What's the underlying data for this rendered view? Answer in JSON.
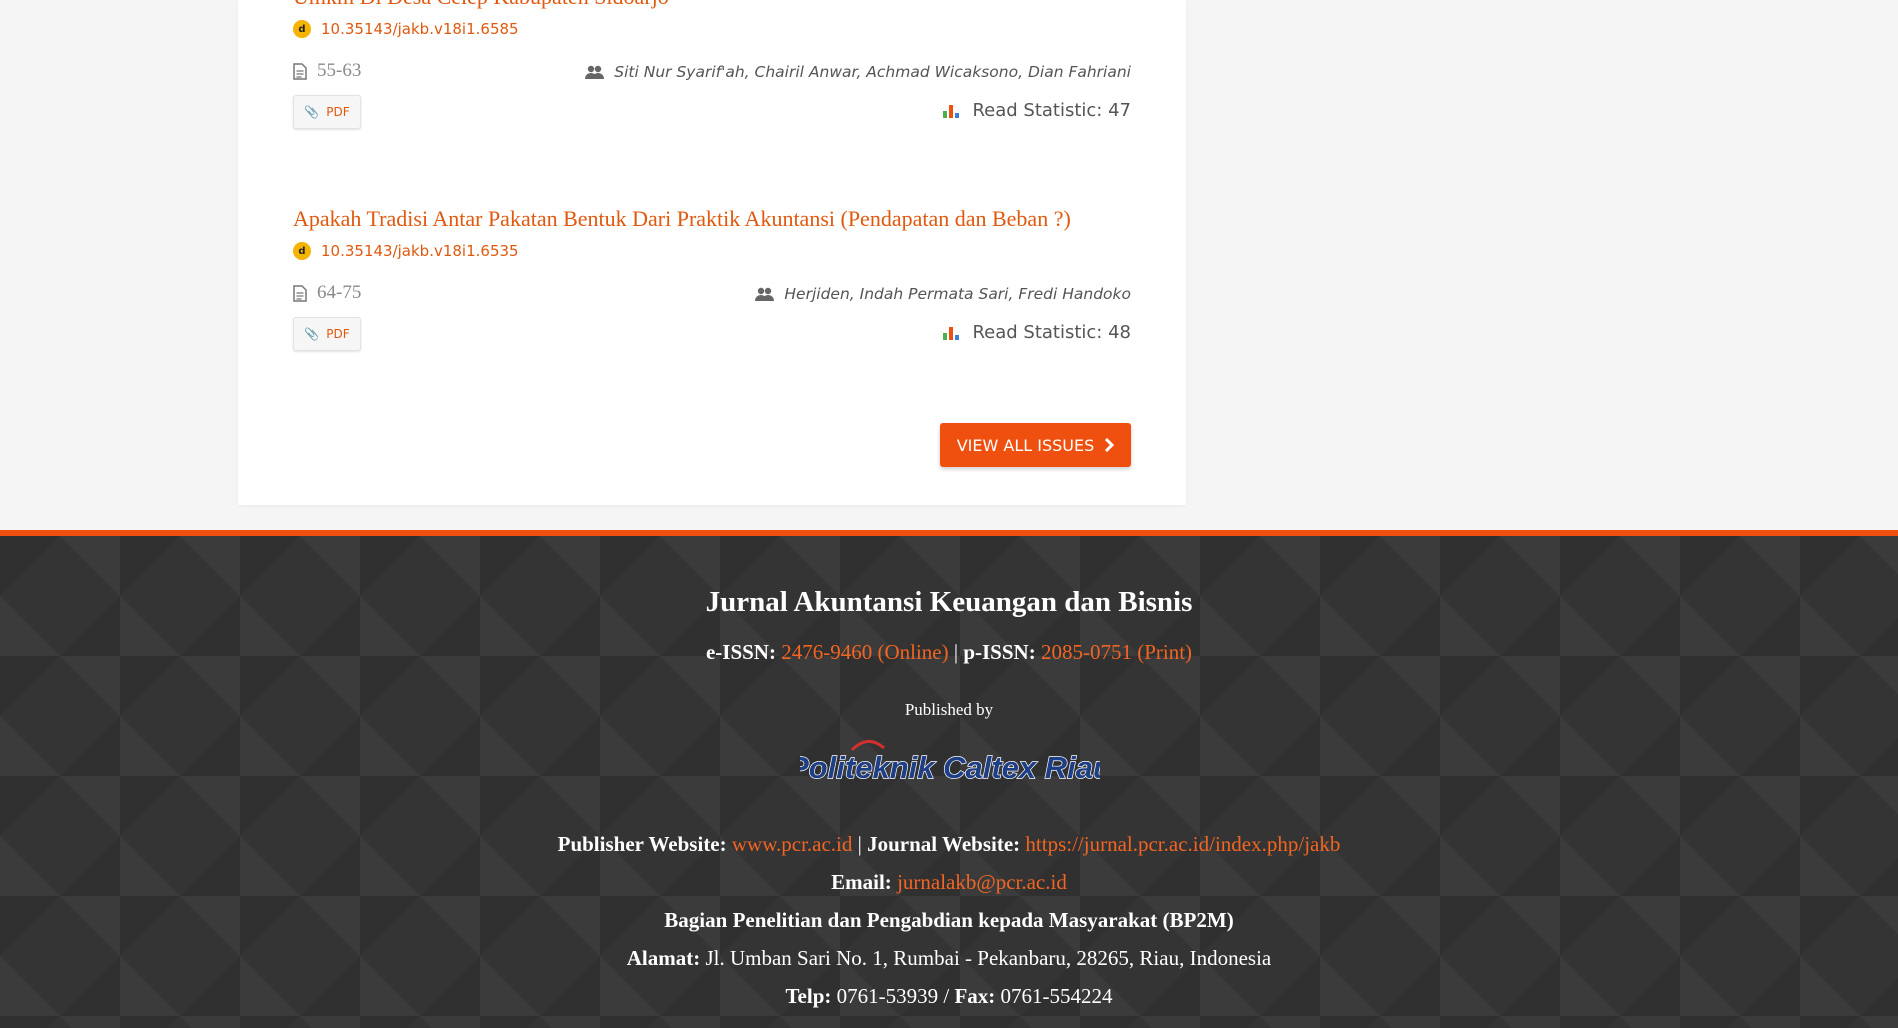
{
  "articles": [
    {
      "title": "Umkm Di Desa Celep Kabupaten Sidoarjo",
      "doi": "10.35143/jakb.v18i1.6585",
      "pages": "55-63",
      "authors": "Siti Nur Syarif'ah, Chairil Anwar, Achmad Wicaksono, Dian Fahriani",
      "pdf_label": "PDF",
      "read_statistic": "Read Statistic: 47"
    },
    {
      "title": "Apakah Tradisi Antar Pakatan Bentuk Dari Praktik Akuntansi (Pendapatan dan Beban ?)",
      "doi": "10.35143/jakb.v18i1.6535",
      "pages": "64-75",
      "authors": "Herjiden, Indah Permata Sari, Fredi Handoko",
      "pdf_label": "PDF",
      "read_statistic": "Read Statistic: 48"
    }
  ],
  "view_all": {
    "label": "VIEW ALL ISSUES",
    "icon": "chevron-right-icon"
  },
  "footer": {
    "journal_title": "Jurnal Akuntansi Keuangan dan Bisnis",
    "eissn_label": "e-ISSN:",
    "eissn_value": "2476-9460 (Online)",
    "separator": "|",
    "pissn_label": "p-ISSN:",
    "pissn_value": "2085-0751 (Print)",
    "published_by": "Published by",
    "publisher_logo_text": "Politeknik Caltex Riau",
    "publisher_website_label": "Publisher Website:",
    "publisher_website": "www.pcr.ac.id",
    "journal_website_label": "Journal Website:",
    "journal_website": "https://jurnal.pcr.ac.id/index.php/jakb",
    "email_label": "Email:",
    "email": "jurnalakb@pcr.ac.id",
    "department": "Bagian Penelitian dan Pengabdian kepada Masyarakat (BP2M)",
    "address_label": "Alamat:",
    "address": "Jl. Umban Sari No. 1, Rumbai - Pekanbaru, 28265, Riau, Indonesia",
    "phone_label": "Telp:",
    "phone": "0761-53939",
    "slash": "/",
    "fax_label": "Fax:",
    "fax": "0761-554224"
  },
  "colors": {
    "accent": "#e0590f",
    "button": "#f0500f",
    "footer_bg": "#343434",
    "footer_link": "#f26522"
  }
}
